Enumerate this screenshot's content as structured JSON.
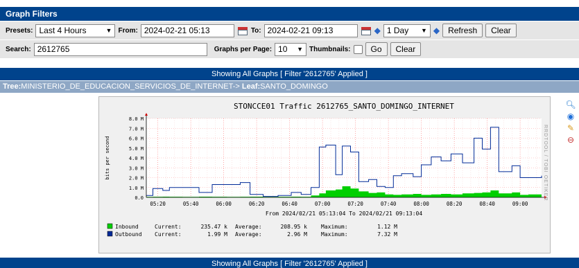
{
  "filters": {
    "title": "Graph Filters",
    "presets_label": "Presets:",
    "presets_value": "Last 4 Hours",
    "from_label": "From:",
    "from_value": "2024-02-21 05:13",
    "to_label": "To:",
    "to_value": "2024-02-21 09:13",
    "span_value": "1 Day",
    "refresh_label": "Refresh",
    "clear_label": "Clear",
    "search_label": "Search:",
    "search_value": "2612765",
    "graphs_per_page_label": "Graphs per Page:",
    "graphs_per_page_value": "10",
    "thumbnails_label": "Thumbnails:",
    "go_label": "Go",
    "clear2_label": "Clear"
  },
  "banner": {
    "showing": "Showing All Graphs [ Filter '2612765' Applied ]"
  },
  "tree": {
    "tree_label": "Tree:",
    "tree_value": "MINISTERIO_DE_EDUCACION_SERVICIOS_DE_INTERNET->",
    "leaf_label": "Leaf:",
    "leaf_value": "SANTO_DOMINGO"
  },
  "side_icons": [
    "zoom-icon",
    "properties-icon",
    "edit-icon",
    "delete-icon"
  ],
  "chart_data": {
    "type": "area",
    "title": "STONCCE01 Traffic 2612765_SANTO_DOMINGO_INTERNET",
    "ylabel": "bits per second",
    "watermark": "RRDTOOL / TOBI OETIKER",
    "ylim": [
      0,
      8.0
    ],
    "y_ticks": [
      "0.0",
      "1.0 M",
      "2.0 M",
      "3.0 M",
      "4.0 M",
      "5.0 M",
      "6.0 M",
      "7.0 M",
      "8.0 M"
    ],
    "x_ticks": [
      "05:20",
      "05:40",
      "06:00",
      "06:20",
      "06:40",
      "07:00",
      "07:20",
      "07:40",
      "08:00",
      "08:20",
      "08:40",
      "09:00"
    ],
    "range_text": "From 2024/02/21 05:13:04 To 2024/02/21 09:13:04",
    "series": [
      {
        "name": "Inbound",
        "color": "#00cf00",
        "x": [
          "05:13",
          "05:17",
          "05:23",
          "05:27",
          "05:35",
          "05:45",
          "05:53",
          "06:02",
          "06:10",
          "06:16",
          "06:24",
          "06:33",
          "06:41",
          "06:47",
          "06:53",
          "06:58",
          "07:02",
          "07:08",
          "07:12",
          "07:17",
          "07:22",
          "07:28",
          "07:33",
          "07:38",
          "07:43",
          "07:48",
          "07:55",
          "08:00",
          "08:06",
          "08:12",
          "08:18",
          "08:25",
          "08:32",
          "08:37",
          "08:42",
          "08:47",
          "08:55",
          "09:00",
          "09:05",
          "09:13"
        ],
        "values": [
          0.05,
          0.06,
          0.07,
          0.06,
          0.05,
          0.07,
          0.06,
          0.05,
          0.06,
          0.07,
          0.05,
          0.06,
          0.07,
          0.06,
          0.2,
          0.4,
          0.7,
          0.8,
          1.12,
          0.9,
          0.6,
          0.45,
          0.5,
          0.3,
          0.25,
          0.3,
          0.35,
          0.25,
          0.3,
          0.35,
          0.3,
          0.4,
          0.45,
          0.5,
          0.7,
          0.4,
          0.5,
          0.25,
          0.3,
          0.1
        ]
      },
      {
        "name": "Outbound",
        "color": "#002a97",
        "x": [
          "05:13",
          "05:17",
          "05:23",
          "05:27",
          "05:35",
          "05:45",
          "05:53",
          "06:02",
          "06:10",
          "06:16",
          "06:24",
          "06:33",
          "06:41",
          "06:47",
          "06:53",
          "06:58",
          "07:02",
          "07:08",
          "07:12",
          "07:17",
          "07:22",
          "07:28",
          "07:33",
          "07:38",
          "07:43",
          "07:48",
          "07:55",
          "08:00",
          "08:06",
          "08:12",
          "08:18",
          "08:25",
          "08:32",
          "08:37",
          "08:42",
          "08:47",
          "08:55",
          "09:00",
          "09:05",
          "09:13"
        ],
        "values": [
          0.2,
          0.9,
          0.7,
          1.0,
          1.0,
          0.5,
          1.3,
          1.3,
          1.5,
          0.3,
          0.1,
          0.2,
          0.5,
          0.3,
          1.0,
          5.1,
          5.3,
          2.3,
          5.2,
          4.6,
          1.6,
          1.8,
          1.1,
          1.0,
          2.2,
          2.4,
          2.1,
          3.3,
          4.1,
          3.7,
          4.4,
          3.5,
          6.0,
          4.9,
          7.1,
          2.6,
          3.2,
          2.0,
          2.0,
          2.2
        ]
      }
    ],
    "legend": [
      {
        "name": "Inbound",
        "color": "#00cf00",
        "current_label": "Current:",
        "current": "235.47 k",
        "average_label": "Average:",
        "average": "208.95 k",
        "maximum_label": "Maximum:",
        "maximum": "1.12 M"
      },
      {
        "name": "Outbound",
        "color": "#002a97",
        "current_label": "Current:",
        "current": "1.99 M",
        "average_label": "Average:",
        "average": "2.96 M",
        "maximum_label": "Maximum:",
        "maximum": "7.32 M"
      }
    ]
  }
}
